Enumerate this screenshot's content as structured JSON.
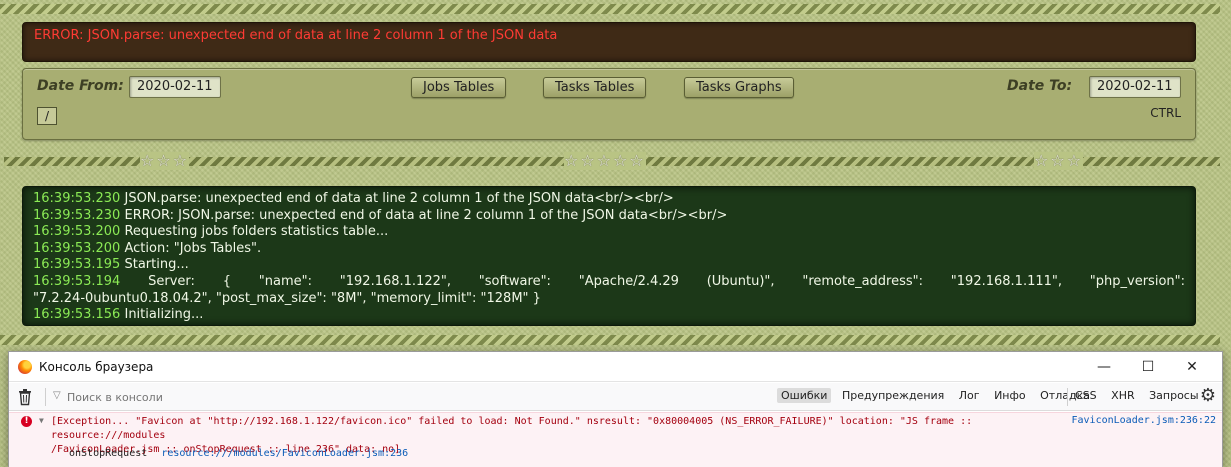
{
  "error_banner": {
    "message": "ERROR: JSON.parse: unexpected end of data at line 2 column 1 of the JSON data"
  },
  "controls": {
    "date_from_label": "Date From:",
    "date_from_value": "2020-02-11",
    "date_to_label": "Date To:",
    "date_to_value": "2020-02-11",
    "buttons": [
      "Jobs Tables",
      "Tasks Tables",
      "Tasks Graphs"
    ],
    "small_box_text": "/",
    "ctrl_text": "CTRL"
  },
  "separator": {
    "stars_left": "☆☆☆",
    "stars_center": "☆☆☆☆☆",
    "stars_right": "☆☆☆"
  },
  "log": {
    "lines": [
      {
        "ts": "16:39:53.230",
        "text": "JSON.parse: unexpected end of data at line 2 column 1 of the JSON data<br/><br/>"
      },
      {
        "ts": "16:39:53.230",
        "text": "ERROR: JSON.parse: unexpected end of data at line 2 column 1 of the JSON data<br/><br/>"
      },
      {
        "ts": "16:39:53.200",
        "text": "Requesting jobs folders statistics table..."
      },
      {
        "ts": "16:39:53.200",
        "text": "Action: \"Jobs Tables\"."
      },
      {
        "ts": "16:39:53.195",
        "text": "Starting..."
      }
    ],
    "server_ts": "16:39:53.194",
    "server_text": "Server: { \"name\": \"192.168.1.122\", \"software\": \"Apache/2.4.29 (Ubuntu)\", \"remote_address\": \"192.168.1.111\", \"php_version\":",
    "server_text_cont": "\"7.2.24-0ubuntu0.18.04.2\", \"post_max_size\": \"8M\", \"memory_limit\": \"128M\" }",
    "last": {
      "ts": "16:39:53.156",
      "text": "Initializing..."
    }
  },
  "console": {
    "title": "Консоль браузера",
    "window_buttons": {
      "minimize": "—",
      "maximize": "☐",
      "close": "✕"
    },
    "filter_placeholder": "Поиск в консоли",
    "filter_tabs": [
      {
        "label": "Ошибки",
        "active": true
      },
      {
        "label": "Предупреждения",
        "active": false
      },
      {
        "label": "Лог",
        "active": false
      },
      {
        "label": "Инфо",
        "active": false
      },
      {
        "label": "Отладка",
        "active": false
      }
    ],
    "request_tabs": [
      "CSS",
      "XHR",
      "Запросы"
    ],
    "error": {
      "line1": "[Exception... \"Favicon at \"http://192.168.1.122/favicon.ico\" failed to load: Not Found.\"  nsresult: \"0x80004005 (NS_ERROR_FAILURE)\"  location: \"JS frame :: resource:///modules",
      "line2": "/FaviconLoader.jsm :: onStopRequest :: line 236\"  data: no]",
      "source": "FaviconLoader.jsm:236:22",
      "stack_fn": "onStopRequest",
      "stack_link": "resource:///modules/FaviconLoader.jsm:236"
    }
  }
}
